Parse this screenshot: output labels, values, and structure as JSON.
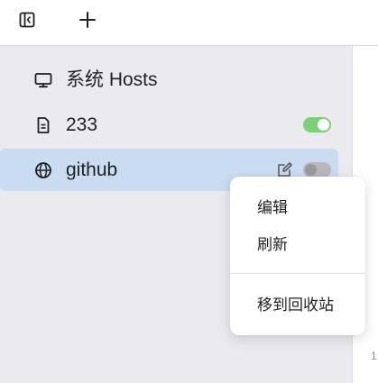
{
  "toolbar": {
    "sidebar_toggle_icon": "sidebar-toggle-icon",
    "add_icon": "plus-icon"
  },
  "sidebar": {
    "items": [
      {
        "label": "系统 Hosts",
        "icon": "monitor-icon"
      },
      {
        "label": "233",
        "icon": "document-icon",
        "enabled": true
      },
      {
        "label": "github",
        "icon": "globe-icon",
        "enabled": false,
        "selected": true,
        "edit_icon": "edit-icon"
      }
    ]
  },
  "context_menu": {
    "items": [
      "编辑",
      "刷新",
      "移到回收站"
    ]
  },
  "editor": {
    "line_number": "1"
  },
  "colors": {
    "selected_bg": "#c9dcf2",
    "toggle_on": "#7fcf79",
    "toggle_off": "#b8b8bc",
    "sidebar_bg": "#ebebef"
  }
}
